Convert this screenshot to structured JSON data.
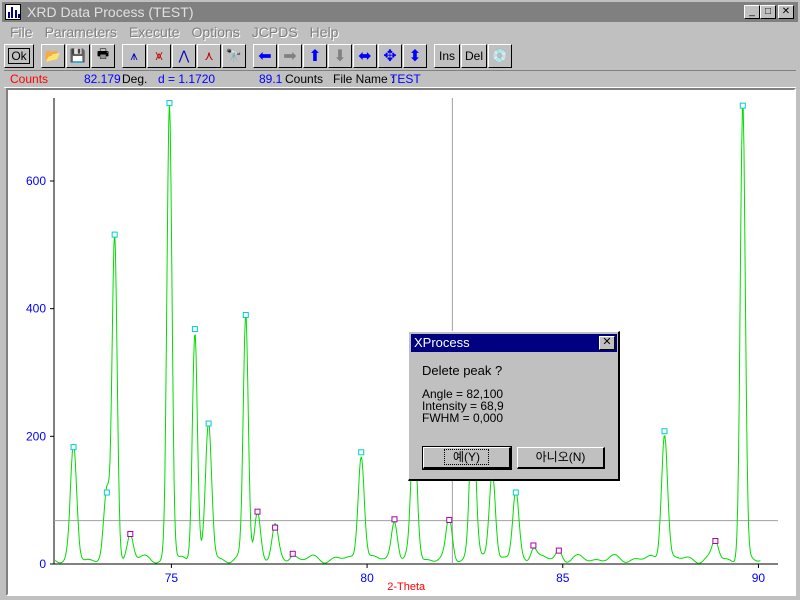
{
  "window": {
    "title": "XRD Data Process (TEST)",
    "controls": {
      "minimize": "_",
      "maximize": "□",
      "close": "✕"
    }
  },
  "menu": [
    "File",
    "Parameters",
    "Execute",
    "Options",
    "JCPDS",
    "Help"
  ],
  "toolbar": {
    "ok": "Ok",
    "icons": [
      {
        "name": "open-folder-icon",
        "glyph": "📂"
      },
      {
        "name": "save-disk-icon",
        "glyph": "💾"
      },
      {
        "name": "print-icon",
        "glyph": "🖶"
      },
      {
        "name": "spectrum-blue-icon",
        "glyph": "⩚"
      },
      {
        "name": "spectrum-red-icon",
        "glyph": "⩙"
      },
      {
        "name": "spectrum-peaks-icon",
        "glyph": "⋀"
      },
      {
        "name": "spectrum-red-peaks-icon",
        "glyph": "⋏"
      },
      {
        "name": "binoculars-icon",
        "glyph": "🔭"
      },
      {
        "name": "arrow-left-icon",
        "glyph": "⬅"
      },
      {
        "name": "arrow-right-icon",
        "glyph": "➡"
      },
      {
        "name": "arrow-up-icon",
        "glyph": "⬆"
      },
      {
        "name": "arrow-down-icon",
        "glyph": "⬇"
      },
      {
        "name": "expand-horizontal-icon",
        "glyph": "⬌"
      },
      {
        "name": "expand-all-icon",
        "glyph": "✥"
      },
      {
        "name": "expand-vertical-icon",
        "glyph": "⬍"
      }
    ],
    "ins": "Ins",
    "del": "Del",
    "disc_icon": "💿"
  },
  "status": {
    "counts_label": "Counts",
    "angle_value": "82.179",
    "angle_unit": "Deg.",
    "d_value": "d = 1.1720",
    "count_value": "89.1",
    "count_unit": "Counts",
    "file_label": "File Name :",
    "file_name": "TEST"
  },
  "colors": {
    "axis_text": "#0000ff",
    "xlabel": "#ff0000",
    "curve": "#00dd00",
    "marker_cyan": "#00cccc",
    "marker_magenta": "#aa00aa"
  },
  "chart_data": {
    "type": "line",
    "xlabel": "2-Theta",
    "ylabel": "",
    "xlim": [
      72.0,
      90.5
    ],
    "ylim": [
      0,
      730
    ],
    "x_ticks": [
      75,
      80,
      85,
      90
    ],
    "y_ticks": [
      0,
      200,
      400,
      600
    ],
    "cursor_x": 82.179,
    "threshold_y": 68,
    "peaks_detected": [
      {
        "x": 72.5,
        "y": 183
      },
      {
        "x": 73.35,
        "y": 112
      },
      {
        "x": 73.55,
        "y": 516
      },
      {
        "x": 74.95,
        "y": 722
      },
      {
        "x": 75.6,
        "y": 368
      },
      {
        "x": 75.95,
        "y": 220
      },
      {
        "x": 76.9,
        "y": 390
      },
      {
        "x": 79.85,
        "y": 175
      },
      {
        "x": 87.6,
        "y": 208
      },
      {
        "x": 89.6,
        "y": 718
      },
      {
        "x": 83.8,
        "y": 112
      }
    ],
    "peaks_minor": [
      {
        "x": 73.95,
        "y": 47
      },
      {
        "x": 77.2,
        "y": 82
      },
      {
        "x": 77.65,
        "y": 57
      },
      {
        "x": 78.1,
        "y": 16
      },
      {
        "x": 80.7,
        "y": 70
      },
      {
        "x": 82.1,
        "y": 69
      },
      {
        "x": 84.25,
        "y": 29
      },
      {
        "x": 84.9,
        "y": 21
      },
      {
        "x": 88.9,
        "y": 36
      }
    ],
    "hidden_peaks": [
      {
        "x": 81.2,
        "y": 210
      },
      {
        "x": 82.7,
        "y": 240
      },
      {
        "x": 83.2,
        "y": 150
      }
    ],
    "background": 8
  },
  "dialog": {
    "title": "XProcess",
    "question": "Delete peak ?",
    "angle": "Angle = 82,100",
    "intensity": "Intensity = 68,9",
    "fwhm": "FWHM = 0,000",
    "yes": "예(Y)",
    "no": "아니오(N)"
  }
}
